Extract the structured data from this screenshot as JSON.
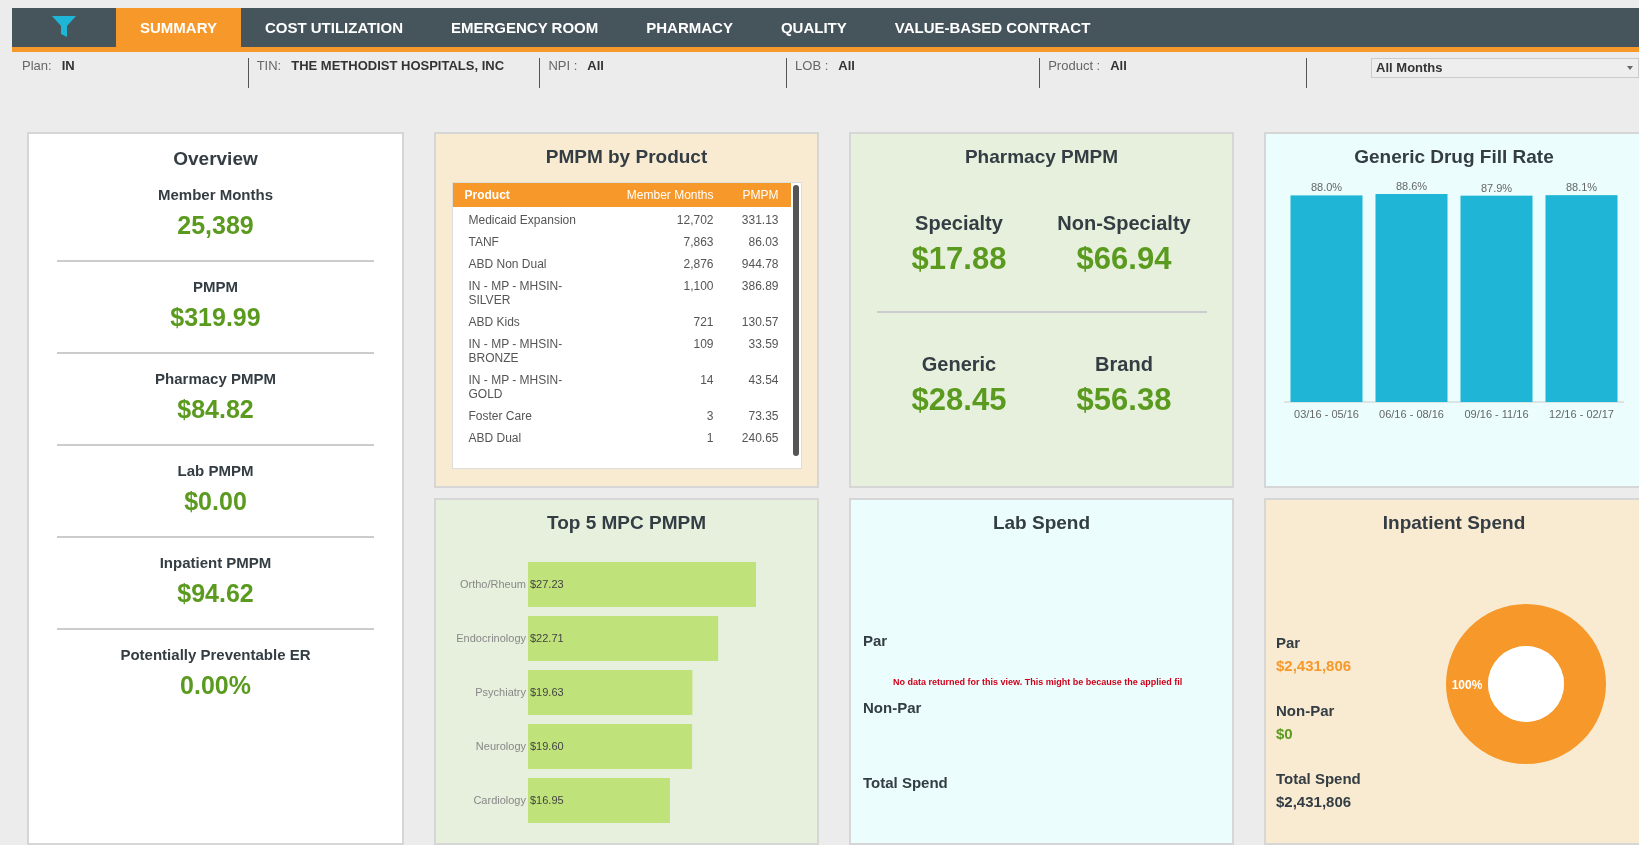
{
  "nav": {
    "tabs": [
      {
        "label": "SUMMARY",
        "selected": true
      },
      {
        "label": "COST UTILIZATION",
        "selected": false
      },
      {
        "label": "EMERGENCY ROOM",
        "selected": false
      },
      {
        "label": "PHARMACY",
        "selected": false
      },
      {
        "label": "QUALITY",
        "selected": false
      },
      {
        "label": "VALUE-BASED CONTRACT",
        "selected": false
      }
    ]
  },
  "filters": [
    {
      "label": "Plan:",
      "value": "IN"
    },
    {
      "label": "TIN:",
      "value": "THE METHODIST HOSPITALS, INC"
    },
    {
      "label": "NPI :",
      "value": "All"
    },
    {
      "label": "LOB :",
      "value": "All"
    },
    {
      "label": "Product :",
      "value": "All"
    }
  ],
  "months_dropdown": {
    "value": "All Months"
  },
  "overview": {
    "title": "Overview",
    "metrics": [
      {
        "label": "Member Months",
        "value": "25,389"
      },
      {
        "label": "PMPM",
        "value": "$319.99"
      },
      {
        "label": "Pharmacy PMPM",
        "value": "$84.82"
      },
      {
        "label": "Lab PMPM",
        "value": "$0.00"
      },
      {
        "label": "Inpatient PMPM",
        "value": "$94.62"
      },
      {
        "label": "Potentially Preventable ER",
        "value": "0.00%"
      }
    ]
  },
  "pmpm_by_product": {
    "title": "PMPM by Product",
    "columns": [
      "Product",
      "Member Months",
      "PMPM"
    ],
    "rows": [
      [
        "Medicaid Expansion",
        "12,702",
        "331.13"
      ],
      [
        "TANF",
        "7,863",
        "86.03"
      ],
      [
        "ABD Non Dual",
        "2,876",
        "944.78"
      ],
      [
        "IN - MP - MHSIN-SILVER",
        "1,100",
        "386.89"
      ],
      [
        "ABD Kids",
        "721",
        "130.57"
      ],
      [
        "IN - MP - MHSIN-BRONZE",
        "109",
        "33.59"
      ],
      [
        "IN - MP - MHSIN-GOLD",
        "14",
        "43.54"
      ],
      [
        "Foster Care",
        "3",
        "73.35"
      ],
      [
        "ABD Dual",
        "1",
        "240.65"
      ]
    ]
  },
  "pharmacy_pmpm": {
    "title": "Pharmacy PMPM",
    "metrics": [
      {
        "label": "Specialty",
        "value": "$17.88"
      },
      {
        "label": "Non-Specialty",
        "value": "$66.94"
      },
      {
        "label": "Generic",
        "value": "$28.45"
      },
      {
        "label": "Brand",
        "value": "$56.38"
      }
    ]
  },
  "generic_drug_fill_rate": {
    "title": "Generic Drug Fill Rate",
    "chart_data": {
      "type": "bar",
      "categories": [
        "03/16 - 05/16",
        "06/16 - 08/16",
        "09/16 - 11/16",
        "12/16 - 02/17"
      ],
      "values": [
        88.0,
        88.6,
        87.9,
        88.1
      ],
      "value_labels": [
        "88.0%",
        "88.6%",
        "87.9%",
        "88.1%"
      ]
    }
  },
  "top5_mpc_pmpm": {
    "title": "Top 5 MPC PMPM",
    "chart_data": {
      "type": "bar",
      "orientation": "horizontal",
      "categories": [
        "Ortho/Rheum",
        "Endocrinology",
        "Psychiatry",
        "Neurology",
        "Cardiology"
      ],
      "values": [
        27.23,
        22.71,
        19.63,
        19.6,
        16.95
      ],
      "value_labels": [
        "$27.23",
        "$22.71",
        "$19.63",
        "$19.60",
        "$16.95"
      ]
    }
  },
  "lab_spend": {
    "title": "Lab Spend",
    "labels": [
      "Par",
      "Non-Par",
      "Total Spend"
    ],
    "message": "No data returned for this view. This might be because the applied fil"
  },
  "inpatient_spend": {
    "title": "Inpatient Spend",
    "items": [
      {
        "label": "Par",
        "value": "$2,431,806",
        "color": "#f7982a"
      },
      {
        "label": "Non-Par",
        "value": "$0",
        "color": "#5a9a1e"
      },
      {
        "label": "Total Spend",
        "value": "$2,431,806",
        "color": "#333d43"
      }
    ],
    "chart_data": {
      "type": "donut",
      "values": [
        100
      ],
      "value_labels": [
        "100%"
      ]
    }
  }
}
